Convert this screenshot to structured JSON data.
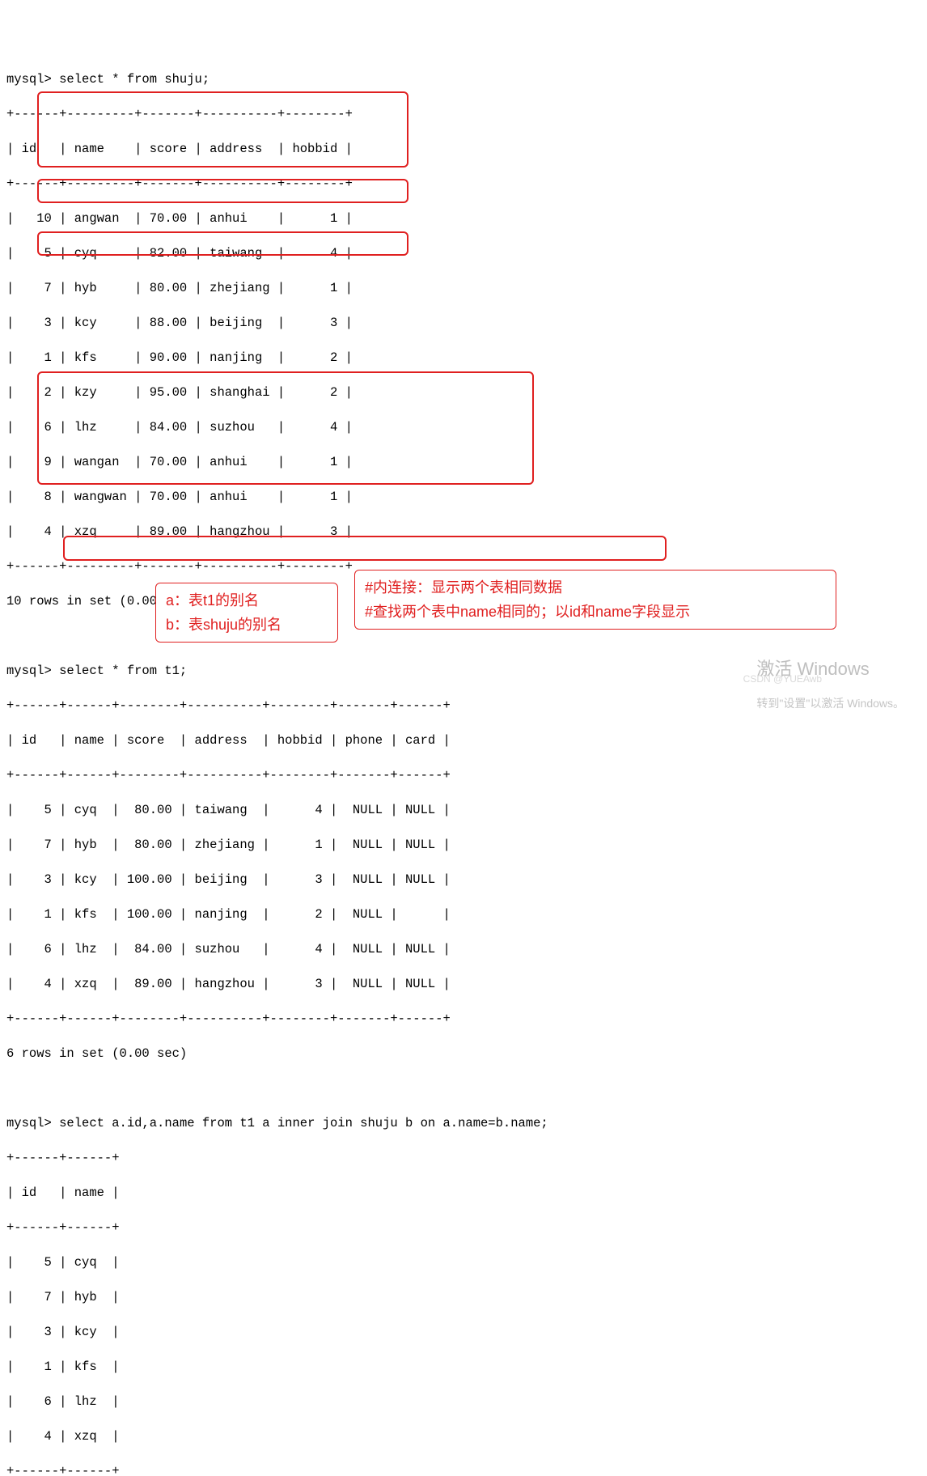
{
  "q1_prompt": "mysql> select * from shuju;",
  "q1_sep": "+------+---------+-------+----------+--------+",
  "q1_head": "| id   | name    | score | address  | hobbid |",
  "q1_rows": [
    "|   10 | angwan  | 70.00 | anhui    |      1 |",
    "|    5 | cyq     | 82.00 | taiwang  |      4 |",
    "|    7 | hyb     | 80.00 | zhejiang |      1 |",
    "|    3 | kcy     | 88.00 | beijing  |      3 |",
    "|    1 | kfs     | 90.00 | nanjing  |      2 |",
    "|    2 | kzy     | 95.00 | shanghai |      2 |",
    "|    6 | lhz     | 84.00 | suzhou   |      4 |",
    "|    9 | wangan  | 70.00 | anhui    |      1 |",
    "|    8 | wangwan | 70.00 | anhui    |      1 |",
    "|    4 | xzq     | 89.00 | hangzhou |      3 |"
  ],
  "q1_foot": "10 rows in set (0.00 sec)",
  "blank": "",
  "q2_prompt": "mysql> select * from t1;",
  "q2_sep": "+------+------+--------+----------+--------+-------+------+",
  "q2_head": "| id   | name | score  | address  | hobbid | phone | card |",
  "q2_rows": [
    "|    5 | cyq  |  80.00 | taiwang  |      4 |  NULL | NULL |",
    "|    7 | hyb  |  80.00 | zhejiang |      1 |  NULL | NULL |",
    "|    3 | kcy  | 100.00 | beijing  |      3 |  NULL | NULL |",
    "|    1 | kfs  | 100.00 | nanjing  |      2 |  NULL |      |",
    "|    6 | lhz  |  84.00 | suzhou   |      4 |  NULL | NULL |",
    "|    4 | xzq  |  89.00 | hangzhou |      3 |  NULL | NULL |"
  ],
  "q2_foot": "6 rows in set (0.00 sec)",
  "q3_prompt_a": "mysql> ",
  "q3_prompt_b": "select a.id,a.name from t1 a inner join shuju b on a.name=b.name;",
  "q3_sep": "+------+------+",
  "q3_head": "| id   | name |",
  "q3_rows": [
    "|    5 | cyq  |",
    "|    7 | hyb  |",
    "|    3 | kcy  |",
    "|    1 | kfs  |",
    "|    6 | lhz  |",
    "|    4 | xzq  |"
  ],
  "ann1_l1": "a：表t1的别名",
  "ann1_l2": "b：表shuju的别名",
  "ann2_l1": "#内连接：显示两个表相同数据",
  "ann2_l2": "#查找两个表中name相同的；以id和name字段显示",
  "wm_title": "激活 Windows",
  "wm_sub": "转到\"设置\"以激活 Windows。",
  "csdn": "CSDN @YUEAwb"
}
